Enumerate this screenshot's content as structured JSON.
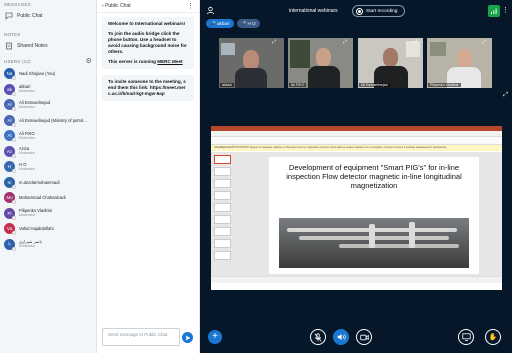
{
  "sidebar": {
    "messages_header": "MESSAGES",
    "public_chat": "Public Chat",
    "notes_header": "NOTES",
    "shared_notes": "Shared Notes",
    "users_header": "USERS (12)",
    "users": [
      {
        "initials": "Na",
        "name": "Nadi Shojaee (You)",
        "role": "",
        "color": "#2a5fb0"
      },
      {
        "initials": "ak",
        "name": "akbari",
        "role": "Moderator",
        "color": "#5b4fb5"
      },
      {
        "initials": "Al",
        "name": "Ali Esmaeilnejad",
        "role": "Moderator",
        "color": "#4a68b8"
      },
      {
        "initials": "Al",
        "name": "Ali Esmaeilnejad (Ministry of petrol...",
        "role": "",
        "color": "#4a68b8"
      },
      {
        "initials": "Al",
        "name": "Ali FIKO",
        "role": "Moderator",
        "color": "#3f73c4"
      },
      {
        "initials": "Az",
        "name": "Aziza",
        "role": "Moderator",
        "color": "#5d52b0"
      },
      {
        "initials": "H",
        "name": "H O",
        "role": "Moderator",
        "color": "#3a69b3"
      },
      {
        "initials": "m",
        "name": "m.dezdarmohammadi",
        "role": "",
        "color": "#2d62a6"
      },
      {
        "initials": "Mo",
        "name": "Mohammad Chahardowli",
        "role": "",
        "color": "#a0326e"
      },
      {
        "initials": "Pi",
        "name": "Pilipenko Vladimir",
        "role": "Moderator",
        "color": "#6349a8"
      },
      {
        "initials": "Va",
        "name": "Vahid Hajabdollahi",
        "role": "",
        "color": "#c5304f"
      },
      {
        "initials": "یا",
        "name": "یاسر شیرازی",
        "role": "Moderator",
        "color": "#2f5fa8"
      }
    ]
  },
  "chat": {
    "title": "Public Chat",
    "welcome_line1": "Welcome to International webinars!",
    "welcome_line2": "To join the audio bridge click the phone button. Use a headset to avoid causing background noise for others.",
    "welcome_line3_prefix": "This server is running ",
    "welcome_link": "MERC Meet",
    "invite_text": "To invite someone to the meeting, send them this link: https://meet.merc.ac.ir/b/nad-kgt-mgw-6ap",
    "input_placeholder": "Send message to Public Chat"
  },
  "main": {
    "title": "international webinars",
    "record_label": "Start recording",
    "talkers": [
      "akbari",
      "H O"
    ],
    "cams": [
      {
        "name": "akbari"
      },
      {
        "name": "Ali FIKO"
      },
      {
        "name": "Ali Esmaeilnejad"
      },
      {
        "name": "Pilipenko Vladimir"
      }
    ]
  },
  "slide": {
    "title": "Development of equipment \"Smart PIG's\" for in-line inspection Flow detector magnetic in-line longitudinal magnetization",
    "warning": "ЗАЩИЩЕННЫЙ ПРОСМОТР Будьте осторожны: файлы из Интернета могут содержать вирусы. Если вам не нужно изменять этот документ, лучше остаться в режиме защищенного просмотра."
  },
  "colors": {
    "accent": "#1b76d2",
    "dark_bg": "#06172a",
    "connection": "#16a34a"
  }
}
